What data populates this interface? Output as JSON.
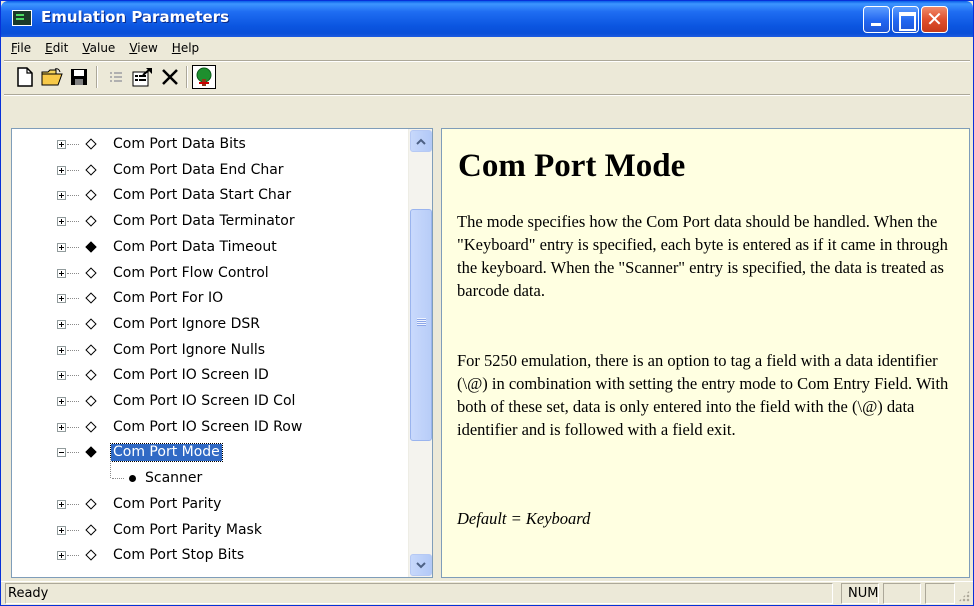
{
  "window": {
    "title": "Emulation Parameters"
  },
  "menu": [
    "File",
    "Edit",
    "Value",
    "View",
    "Help"
  ],
  "toolbar": {
    "buttons": [
      "new-icon",
      "open-folder-icon",
      "save-icon",
      "list-icon",
      "properties-icon",
      "delete-icon",
      "tree-icon"
    ]
  },
  "tree": {
    "items": [
      {
        "label": "Com Port Data Bits",
        "marker": "open"
      },
      {
        "label": "Com Port Data End Char",
        "marker": "open"
      },
      {
        "label": "Com Port Data Start Char",
        "marker": "open"
      },
      {
        "label": "Com Port Data Terminator",
        "marker": "open"
      },
      {
        "label": "Com Port Data Timeout",
        "marker": "filled"
      },
      {
        "label": "Com Port Flow Control",
        "marker": "open"
      },
      {
        "label": "Com Port For IO",
        "marker": "open"
      },
      {
        "label": "Com Port Ignore DSR",
        "marker": "open"
      },
      {
        "label": "Com Port Ignore Nulls",
        "marker": "open"
      },
      {
        "label": "Com Port IO Screen ID",
        "marker": "open"
      },
      {
        "label": "Com Port IO Screen ID Col",
        "marker": "open"
      },
      {
        "label": "Com Port IO Screen ID Row",
        "marker": "open"
      },
      {
        "label": "Com Port Mode",
        "marker": "filled",
        "selected": true,
        "expanded": true,
        "child": "Scanner"
      },
      {
        "label": "Com Port Parity",
        "marker": "open"
      },
      {
        "label": "Com Port Parity Mask",
        "marker": "open"
      },
      {
        "label": "Com Port Stop Bits",
        "marker": "open"
      }
    ]
  },
  "help": {
    "title": "Com Port Mode",
    "para1": "The  mode specifies how the Com Port data should be handled.  When the \"Keyboard\" entry is specified, each byte is entered as if it came in through the keyboard. When the \"Scanner\" entry is specified, the data is treated as barcode data.",
    "para2": "For 5250 emulation, there is an option to tag a field with a data identifier (\\@) in combination with setting the entry mode to Com Entry Field.  With both of these set, data is only entered into the field with the (\\@) data identifier and is followed with a field exit.",
    "default": "Default = Keyboard"
  },
  "status": {
    "text": "Ready",
    "num": "NUM"
  }
}
